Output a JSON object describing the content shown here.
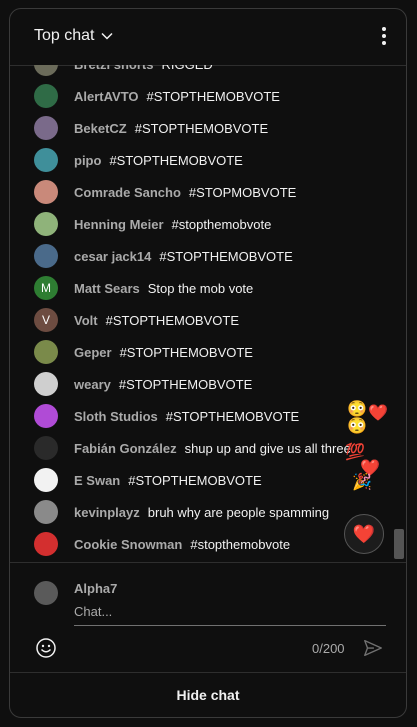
{
  "header": {
    "title": "Top chat"
  },
  "feed": {
    "messages": [
      {
        "author": "Bretzi shorts",
        "text": "RIGGED",
        "avatar_color": "#6b6b5a",
        "initial": ""
      },
      {
        "author": "AlertAVTO",
        "text": "#STOPTHEMOBVOTE",
        "avatar_color": "#2f6b46",
        "initial": ""
      },
      {
        "author": "BeketCZ",
        "text": "#STOPTHEMOBVOTE",
        "avatar_color": "#7a6a8a",
        "initial": ""
      },
      {
        "author": "pipo",
        "text": "#STOPTHEMOBVOTE",
        "avatar_color": "#3f8f9a",
        "initial": ""
      },
      {
        "author": "Comrade Sancho",
        "text": "#STOPMOBVOTE",
        "avatar_color": "#c9897a",
        "initial": ""
      },
      {
        "author": "Henning Meier",
        "text": "#stopthemobvote",
        "avatar_color": "#8fb37a",
        "initial": ""
      },
      {
        "author": "cesar jack14",
        "text": "#STOPTHEMOBVOTE",
        "avatar_color": "#4a6a8a",
        "initial": ""
      },
      {
        "author": "Matt Sears",
        "text": "Stop the mob vote",
        "avatar_color": "#2e7d32",
        "initial": "M"
      },
      {
        "author": "Volt",
        "text": "#STOPTHEMOBVOTE",
        "avatar_color": "#6d4c41",
        "initial": "V"
      },
      {
        "author": "Geper",
        "text": "#STOPTHEMOBVOTE",
        "avatar_color": "#7a8a4a",
        "initial": ""
      },
      {
        "author": "weary",
        "text": "#STOPTHEMOBVOTE",
        "avatar_color": "#cfcfcf",
        "initial": ""
      },
      {
        "author": "Sloth Studios",
        "text": "#STOPTHEMOBVOTE",
        "avatar_color": "#b04bd6",
        "initial": ""
      },
      {
        "author": "Fabián González",
        "text": "shup up and give us all three",
        "avatar_color": "#2a2a2a",
        "initial": ""
      },
      {
        "author": "E Swan",
        "text": "#STOPTHEMOBVOTE",
        "avatar_color": "#f2f2f2",
        "initial": ""
      },
      {
        "author": "kevinplayz",
        "text": "bruh why are people spamming",
        "avatar_color": "#8a8a8a",
        "initial": ""
      },
      {
        "author": "Cookie Snowman",
        "text": "#stopthemobvote",
        "avatar_color": "#d32f2f",
        "initial": ""
      }
    ],
    "floating_emojis": [
      "😳",
      "❤️",
      "😳",
      "💯",
      "❤️",
      "🎉"
    ],
    "reaction_emoji": "❤️"
  },
  "composer": {
    "user_name": "Alpha7",
    "placeholder": "Chat...",
    "counter": "0/200"
  },
  "footer": {
    "hide_label": "Hide chat"
  }
}
